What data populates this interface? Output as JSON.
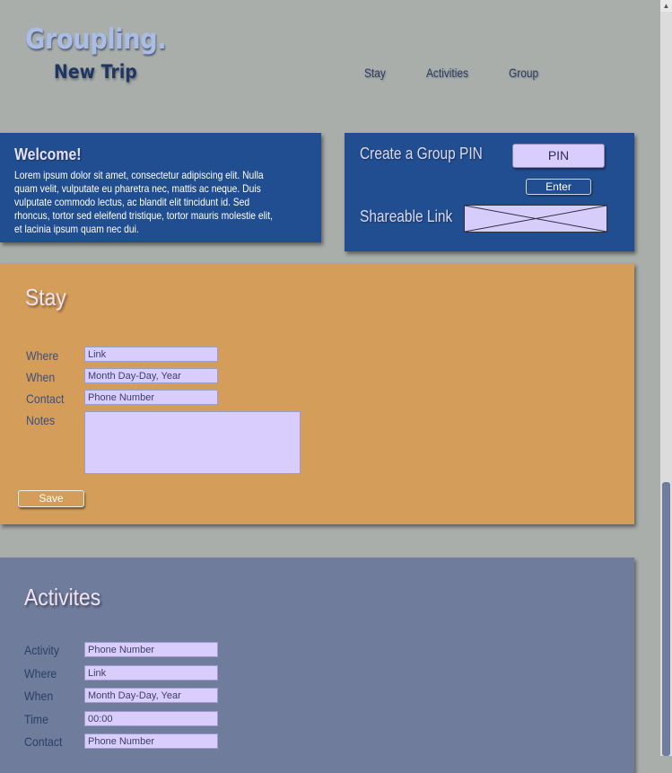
{
  "header": {
    "logo": "Groupling.",
    "subtitle": "New Trip",
    "nav": [
      "Stay",
      "Activities",
      "Group"
    ]
  },
  "welcome": {
    "title": "Welcome!",
    "body": "Lorem ipsum dolor sit amet, consectetur adipiscing elit. Nulla quam velit, vulputate eu pharetra nec, mattis ac neque. Duis vulputate commodo lectus, ac blandit elit tincidunt id. Sed rhoncus, tortor sed eleifend tristique, tortor mauris molestie elit, et lacinia ipsum quam nec dui."
  },
  "pin": {
    "create_label": "Create a Group PIN",
    "pin_placeholder": "PIN",
    "enter_label": "Enter",
    "shareable_label": "Shareable Link"
  },
  "stay": {
    "title": "Stay",
    "fields": [
      {
        "label": "Where",
        "placeholder": "Link"
      },
      {
        "label": "When",
        "placeholder": "Month Day-Day, Year"
      },
      {
        "label": "Contact",
        "placeholder": "Phone Number"
      }
    ],
    "notes_label": "Notes",
    "save_label": "Save"
  },
  "activities": {
    "title": "Activites",
    "fields": [
      {
        "label": "Activity",
        "placeholder": "Phone Number"
      },
      {
        "label": "Where",
        "placeholder": "Link"
      },
      {
        "label": "When",
        "placeholder": "Month Day-Day, Year"
      },
      {
        "label": "Time",
        "placeholder": "00:00"
      },
      {
        "label": "Contact",
        "placeholder": "Phone Number"
      }
    ]
  },
  "colors": {
    "background": "#a9aeab",
    "card_blue": "#214e90",
    "stay_orange": "#d49d5a",
    "activities_slate": "#6f7c9c",
    "input_lavender": "#d9cdfd"
  }
}
